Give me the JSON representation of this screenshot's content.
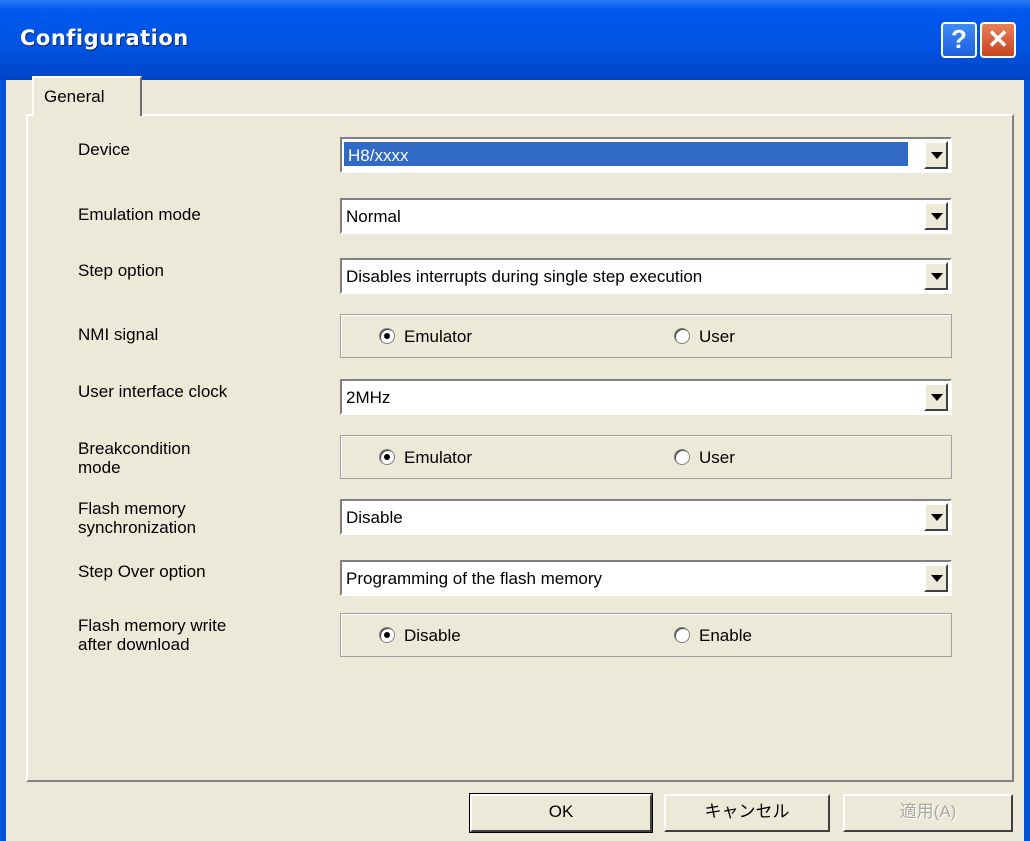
{
  "window": {
    "title": "Configuration"
  },
  "titlebar": {
    "help_label": "?",
    "close_label": "✕"
  },
  "tabs": [
    {
      "label": "General"
    }
  ],
  "fields": [
    {
      "label": "Device",
      "value": "H8/xxxx"
    },
    {
      "label": "Emulation mode",
      "value": "Normal"
    },
    {
      "label": "Step option",
      "value": "Disables interrupts during single step execution"
    },
    {
      "label": "NMI signal",
      "options": [
        "Emulator",
        "User"
      ],
      "selected": "Emulator"
    },
    {
      "label": "User interface clock",
      "value": "2MHz"
    },
    {
      "label_lines": [
        "Breakcondition",
        "mode"
      ],
      "options": [
        "Emulator",
        "User"
      ],
      "selected": "Emulator"
    },
    {
      "label_lines": [
        "Flash memory",
        "synchronization"
      ],
      "value": "Disable"
    },
    {
      "label": "Step Over option",
      "value": "Programming of the flash memory"
    },
    {
      "label_lines": [
        "Flash memory write",
        "after download"
      ],
      "options": [
        "Disable",
        "Enable"
      ],
      "selected": "Disable"
    }
  ],
  "buttons": {
    "ok": "OK",
    "cancel": "キャンセル",
    "apply": "適用(A)"
  },
  "colors": {
    "titlebar": "#0054e3",
    "selection": "#316ac5",
    "face": "#ece9d8"
  }
}
